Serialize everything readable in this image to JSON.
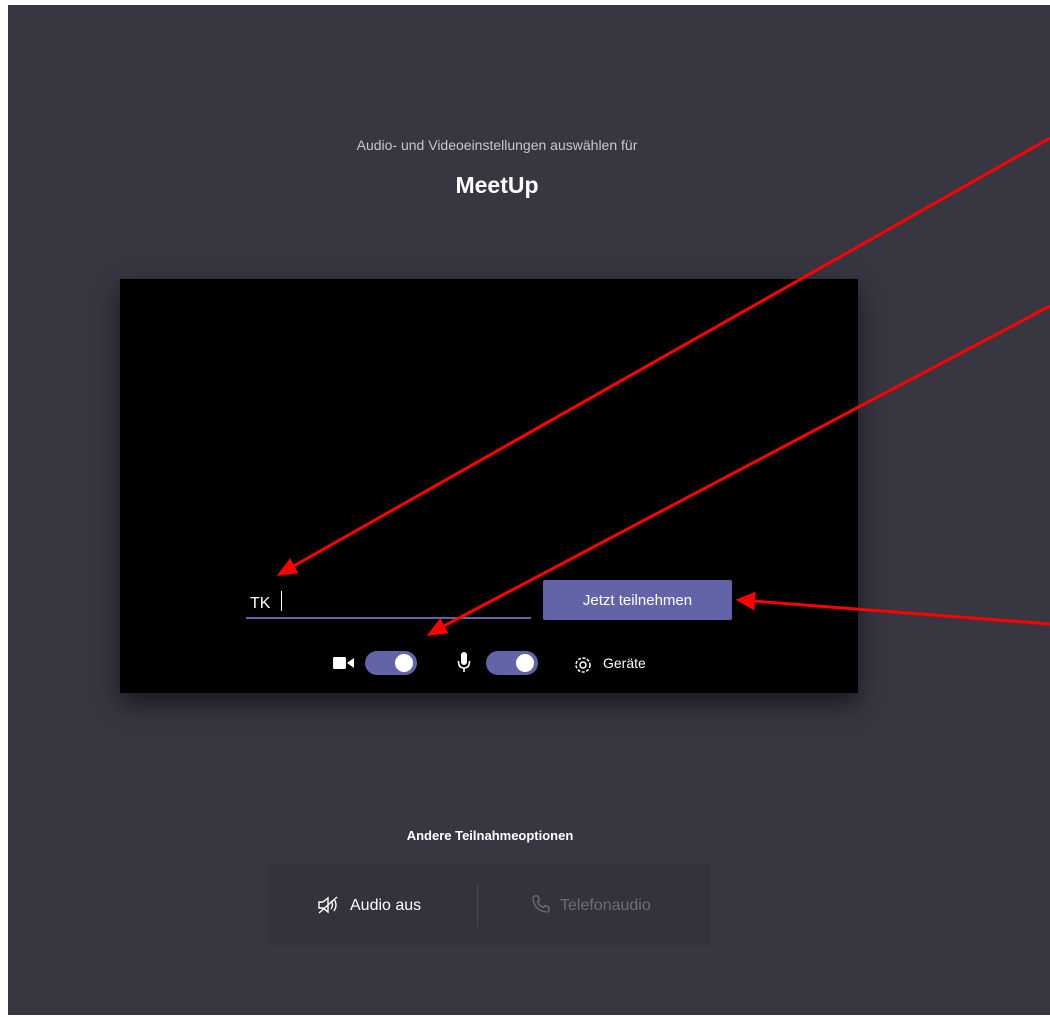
{
  "header": {
    "subtitle": "Audio- und Videoeinstellungen auswählen für",
    "meeting_title": "MeetUp"
  },
  "prejoin": {
    "name_input": {
      "value": "TK"
    },
    "join_button_label": "Jetzt teilnehmen",
    "camera_toggle": {
      "icon": "camera-icon",
      "on": true
    },
    "mic_toggle": {
      "icon": "microphone-icon",
      "on": true
    },
    "devices": {
      "icon": "gear-icon",
      "label": "Geräte"
    }
  },
  "other_options": {
    "title": "Andere Teilnahmeoptionen",
    "audio_off": {
      "icon": "speaker-off-icon",
      "label": "Audio aus"
    },
    "phone_audio": {
      "icon": "phone-icon",
      "label": "Telefonaudio"
    }
  },
  "annotations": {
    "arrow_color": "#ff0000",
    "count": 3
  },
  "colors": {
    "background": "#373641",
    "accent": "#6264a7",
    "preview_background": "#000000",
    "disabled_text": "#6e6d78"
  }
}
